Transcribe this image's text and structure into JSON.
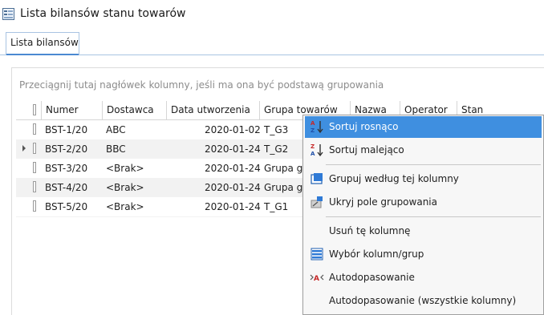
{
  "window": {
    "title": "Lista bilansów stanu towarów",
    "icon": "document-list-icon"
  },
  "tabs": [
    {
      "label": "Lista bilansów",
      "active": true
    }
  ],
  "grid": {
    "grouping_hint": "Przeciągnij tutaj nagłówek kolumny, jeśli ma ona być podstawą grupowania",
    "columns": [
      "Numer",
      "Dostawca",
      "Data utworzenia",
      "Grupa towarów",
      "Nazwa",
      "Operator",
      "Stan"
    ],
    "rows": [
      {
        "numer": "BST-1/20",
        "dostawca": "ABC",
        "data": "2020-01-02",
        "grupa": "T_G3"
      },
      {
        "numer": "BST-2/20",
        "dostawca": "BBC",
        "data": "2020-01-24",
        "grupa": "T_G2",
        "current": true
      },
      {
        "numer": "BST-3/20",
        "dostawca": "<Brak>",
        "data": "2020-01-24",
        "grupa": "Grupa gł"
      },
      {
        "numer": "BST-4/20",
        "dostawca": "<Brak>",
        "data": "2020-01-24",
        "grupa": "Grupa gł"
      },
      {
        "numer": "BST-5/20",
        "dostawca": "<Brak>",
        "data": "2020-01-24",
        "grupa": "T_G1"
      }
    ]
  },
  "context_menu": {
    "items": [
      {
        "label": "Sortuj rosnąco",
        "icon": "sort-ascending-icon",
        "highlighted": true
      },
      {
        "label": "Sortuj malejąco",
        "icon": "sort-descending-icon"
      },
      {
        "label": "Grupuj według tej kolumny",
        "icon": "group-by-column-icon"
      },
      {
        "label": "Ukryj pole grupowania",
        "icon": "hide-group-panel-icon"
      },
      {
        "label": "Usuń tę kolumnę",
        "icon": ""
      },
      {
        "label": "Wybór kolumn/grup",
        "icon": "column-chooser-icon"
      },
      {
        "label": "Autodopasowanie",
        "icon": "autofit-icon"
      },
      {
        "label": "Autodopasowanie (wszystkie kolumny)",
        "icon": ""
      }
    ]
  },
  "colors": {
    "accent": "#3f8fe0",
    "tab_border": "#a9c4e2",
    "hint_text": "#8c8c8c"
  }
}
